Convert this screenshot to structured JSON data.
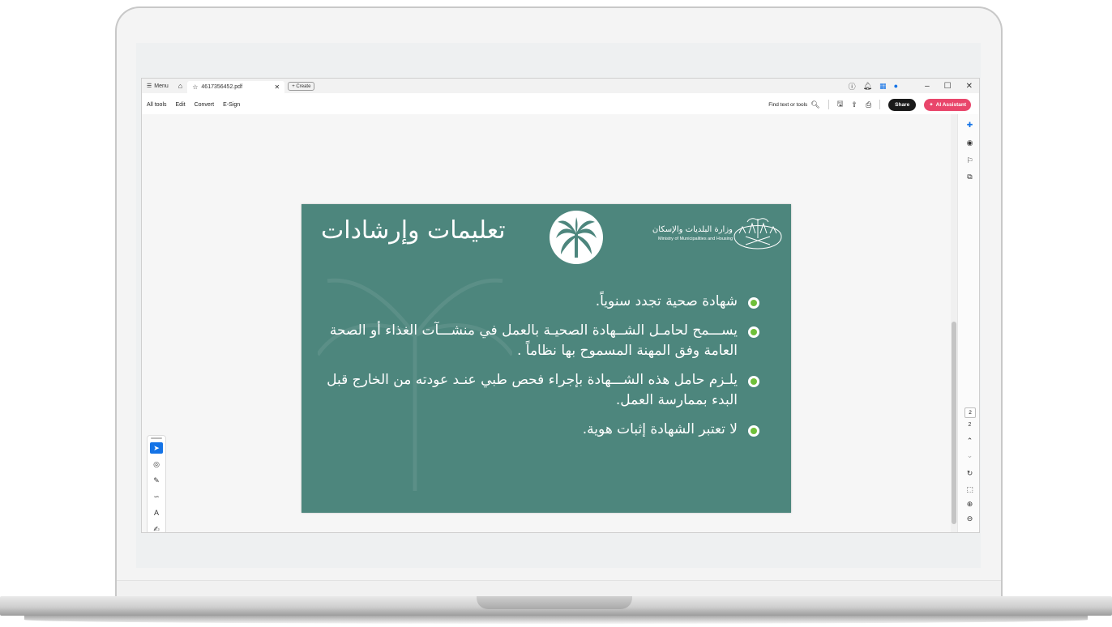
{
  "window": {
    "menu_label": "Menu",
    "tab_title": "4617356452.pdf",
    "create_label": "Create"
  },
  "toolbar": {
    "all_tools": "All tools",
    "edit": "Edit",
    "convert": "Convert",
    "esign": "E-Sign",
    "find_placeholder": "Find text or tools",
    "share": "Share",
    "ai_assistant": "AI Assistant"
  },
  "slide": {
    "title": "تعليمات وإرشادات",
    "ministry_ar": "وزارة البلديات والإسكان",
    "ministry_en": "Ministry of Municipalities and Housing",
    "bullets": [
      "شهادة صحية تجدد سنوياً.",
      "يســـمح لحامـل الشــهادة الصحيـة بالعمل في منشـــآت الغذاء أو الصحة العامة وفق المهنة المسموح بها نظاماً .",
      "يلـزم حامل هذه الشـــهادة بإجراء فحص طبي عنـد عودته من الخارج قبل البدء بممارسة العمل.",
      "لا تعتبر الشهادة إثبات هوية."
    ]
  },
  "navigation": {
    "current_page": "2",
    "total_pages": "2"
  },
  "colors": {
    "slide_bg": "#4d867d",
    "accent_blue": "#1473e6",
    "ai_pink": "#e9466b",
    "bullet_green": "#6fbf3a"
  }
}
